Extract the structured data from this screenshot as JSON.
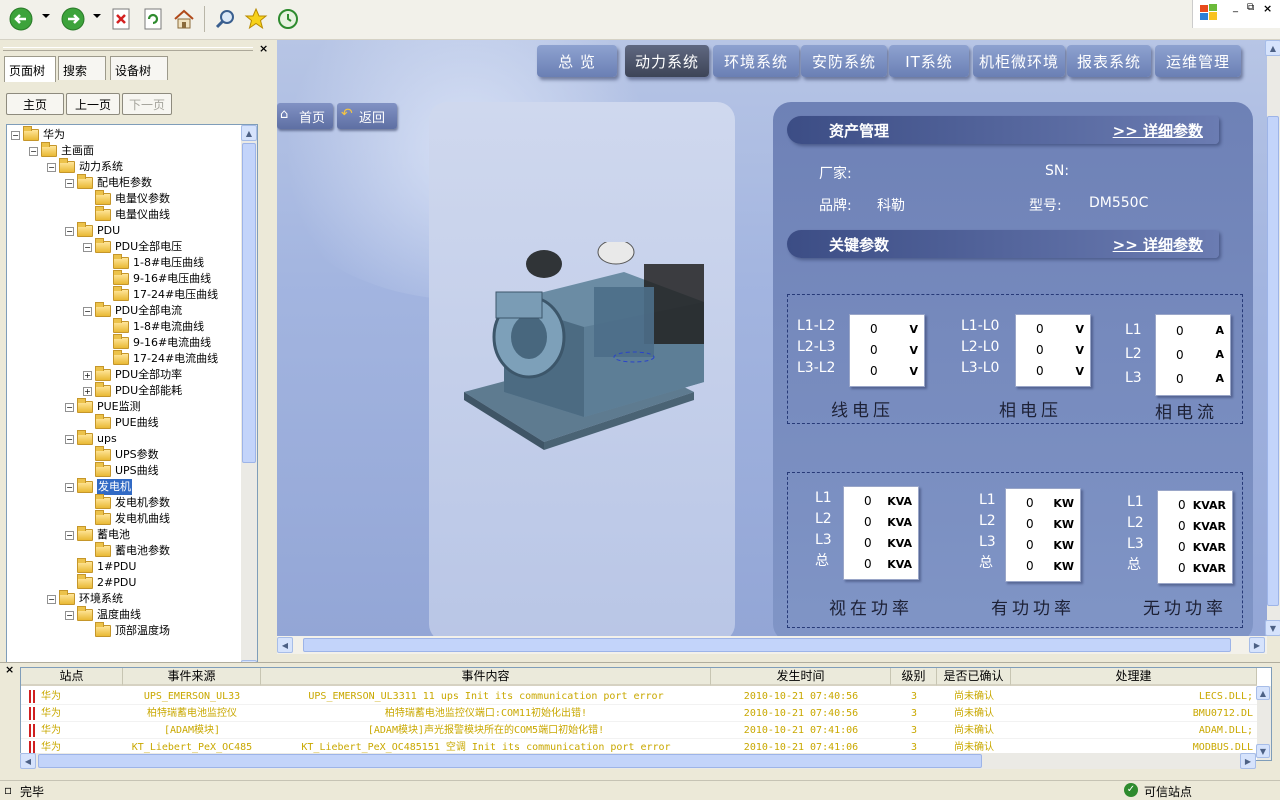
{
  "toolbar": {
    "buttons": [
      "back-icon",
      "forward-icon",
      "stop-icon",
      "refresh-icon",
      "home-icon",
      "search-icon",
      "favorites-icon",
      "history-icon"
    ]
  },
  "left": {
    "tabs": [
      "页面树",
      "搜索",
      "设备树"
    ],
    "nav": {
      "home": "主页",
      "prev": "上一页",
      "next": "下一页"
    },
    "tree": [
      {
        "label": "华为",
        "depth": 0,
        "toggle": "−"
      },
      {
        "label": "主画面",
        "depth": 1,
        "toggle": "−"
      },
      {
        "label": "动力系统",
        "depth": 2,
        "toggle": "−"
      },
      {
        "label": "配电柜参数",
        "depth": 3,
        "toggle": "−"
      },
      {
        "label": "电量仪参数",
        "depth": 4,
        "toggle": ""
      },
      {
        "label": "电量仪曲线",
        "depth": 4,
        "toggle": ""
      },
      {
        "label": "PDU",
        "depth": 3,
        "toggle": "−"
      },
      {
        "label": "PDU全部电压",
        "depth": 4,
        "toggle": "−"
      },
      {
        "label": "1-8#电压曲线",
        "depth": 5,
        "toggle": ""
      },
      {
        "label": "9-16#电压曲线",
        "depth": 5,
        "toggle": ""
      },
      {
        "label": "17-24#电压曲线",
        "depth": 5,
        "toggle": ""
      },
      {
        "label": "PDU全部电流",
        "depth": 4,
        "toggle": "−"
      },
      {
        "label": "1-8#电流曲线",
        "depth": 5,
        "toggle": ""
      },
      {
        "label": "9-16#电流曲线",
        "depth": 5,
        "toggle": ""
      },
      {
        "label": "17-24#电流曲线",
        "depth": 5,
        "toggle": ""
      },
      {
        "label": "PDU全部功率",
        "depth": 4,
        "toggle": "+"
      },
      {
        "label": "PDU全部能耗",
        "depth": 4,
        "toggle": "+"
      },
      {
        "label": "PUE监测",
        "depth": 3,
        "toggle": "−"
      },
      {
        "label": "PUE曲线",
        "depth": 4,
        "toggle": ""
      },
      {
        "label": "ups",
        "depth": 3,
        "toggle": "−"
      },
      {
        "label": "UPS参数",
        "depth": 4,
        "toggle": ""
      },
      {
        "label": "UPS曲线",
        "depth": 4,
        "toggle": ""
      },
      {
        "label": "发电机",
        "depth": 3,
        "toggle": "−",
        "selected": true
      },
      {
        "label": "发电机参数",
        "depth": 4,
        "toggle": ""
      },
      {
        "label": "发电机曲线",
        "depth": 4,
        "toggle": ""
      },
      {
        "label": "蓄电池",
        "depth": 3,
        "toggle": "−"
      },
      {
        "label": "蓄电池参数",
        "depth": 4,
        "toggle": ""
      },
      {
        "label": "1#PDU",
        "depth": 3,
        "toggle": ""
      },
      {
        "label": "2#PDU",
        "depth": 3,
        "toggle": ""
      },
      {
        "label": "环境系统",
        "depth": 2,
        "toggle": "−"
      },
      {
        "label": "温度曲线",
        "depth": 3,
        "toggle": "−"
      },
      {
        "label": "顶部温度场",
        "depth": 4,
        "toggle": ""
      }
    ]
  },
  "main": {
    "tabs": [
      "总 览",
      "动力系统",
      "环境系统",
      "安防系统",
      "IT系统",
      "机柜微环境",
      "报表系统",
      "运维管理"
    ],
    "active_tab": 1,
    "buttons": {
      "home": "首页",
      "back": "返回"
    },
    "asset": {
      "title": "资产管理",
      "link": ">> 详细参数",
      "vendor_label": "厂家:",
      "sn_label": "SN:",
      "brand_label": "品牌:",
      "brand_value": "科勒",
      "model_label": "型号:",
      "model_value": "DM550C"
    },
    "key": {
      "title": "关键参数",
      "link": ">> 详细参数"
    },
    "line_voltage": {
      "caption": "线电压",
      "labels": [
        "L1-L2",
        "L2-L3",
        "L3-L2"
      ],
      "values": [
        "0",
        "0",
        "0"
      ],
      "unit": "V"
    },
    "phase_voltage": {
      "caption": "相电压",
      "labels": [
        "L1-L0",
        "L2-L0",
        "L3-L0"
      ],
      "values": [
        "0",
        "0",
        "0"
      ],
      "unit": "V"
    },
    "phase_current": {
      "caption": "相电流",
      "labels": [
        "L1",
        "L2",
        "L3"
      ],
      "values": [
        "0",
        "0",
        "0"
      ],
      "unit": "A"
    },
    "apparent_power": {
      "caption": "视在功率",
      "labels": [
        "L1",
        "L2",
        "L3",
        "总"
      ],
      "values": [
        "0",
        "0",
        "0",
        "0"
      ],
      "unit": "KVA"
    },
    "active_power": {
      "caption": "有功功率",
      "labels": [
        "L1",
        "L2",
        "L3",
        "总"
      ],
      "values": [
        "0",
        "0",
        "0",
        "0"
      ],
      "unit": "KW"
    },
    "reactive_power": {
      "caption": "无功功率",
      "labels": [
        "L1",
        "L2",
        "L3",
        "总"
      ],
      "values": [
        "0",
        "0",
        "0",
        "0"
      ],
      "unit": "KVAR"
    }
  },
  "events": {
    "headers": [
      "站点",
      "事件来源",
      "事件内容",
      "发生时间",
      "级别",
      "是否已确认",
      "处理建"
    ],
    "rows": [
      [
        "华为",
        "UPS_EMERSON_UL33",
        "UPS_EMERSON_UL3311 11 ups Init its communication port error",
        "2010-10-21 07:40:56",
        "3",
        "尚未确认",
        "LECS.DLL;"
      ],
      [
        "华为",
        "柏特瑞蓄电池监控仪",
        "柏特瑞蓄电池监控仪端口:COM11初始化出错!",
        "2010-10-21 07:40:56",
        "3",
        "尚未确认",
        "BMU0712.DL"
      ],
      [
        "华为",
        "[ADAM模块]",
        "[ADAM模块]声光报警模块所在的COM5端口初始化错!",
        "2010-10-21 07:41:06",
        "3",
        "尚未确认",
        "ADAM.DLL;"
      ],
      [
        "华为",
        "KT_Liebert_PeX_OC485",
        "KT_Liebert_PeX_OC485151 空调 Init its communication port error",
        "2010-10-21 07:41:06",
        "3",
        "尚未确认",
        "MODBUS.DLL"
      ]
    ]
  },
  "status": {
    "left": "完毕",
    "right": "可信站点"
  },
  "colors": {
    "event_text": "#c9a800",
    "tree_selected": "#316ac5",
    "active_tab": "#3d4457"
  }
}
